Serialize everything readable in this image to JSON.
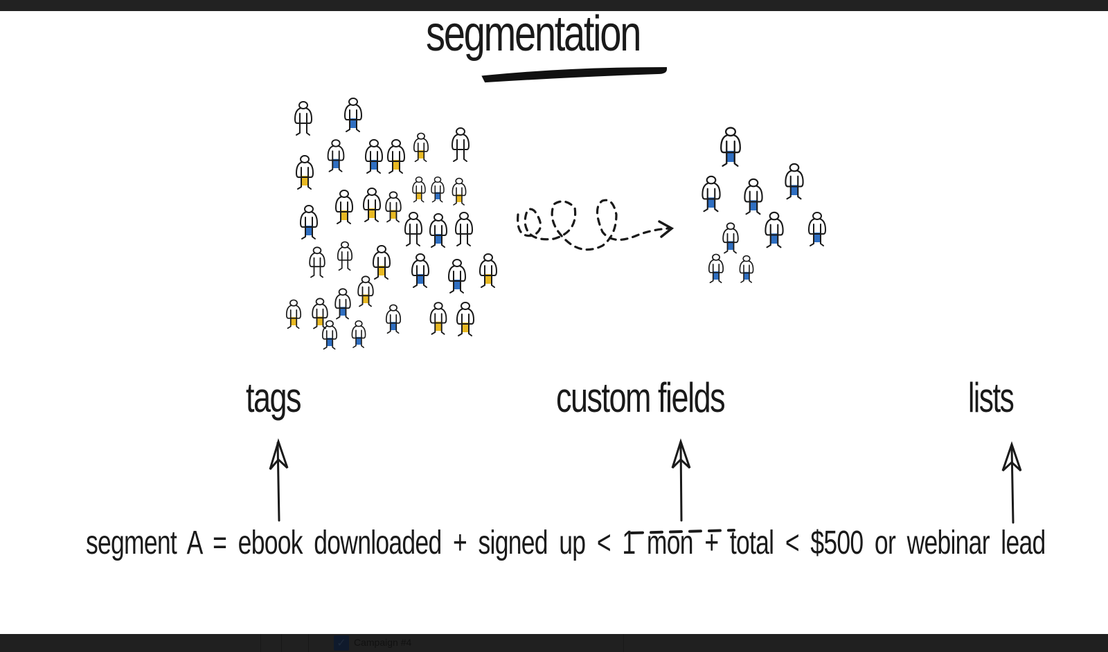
{
  "slide": {
    "title": "segmentation",
    "labels": {
      "tags": "tags",
      "custom_fields": "custom fields",
      "lists": "lists"
    },
    "formula": "segment A = ebook downloaded + signed up < 1 mon + total < $500 or webinar lead",
    "illustration": {
      "crowd_description": "large mixed crowd of people (yellow and blue trousers)",
      "segment_description": "smaller group of people (blue trousers)",
      "connector": "dashed looping arrow",
      "colors": {
        "ink": "#1a1a1a",
        "yellow": "#e8b923",
        "blue": "#2f6fc2"
      }
    }
  },
  "taskbar": {
    "item_label": "Campaign #4",
    "item_icon": "checkmark-icon"
  }
}
